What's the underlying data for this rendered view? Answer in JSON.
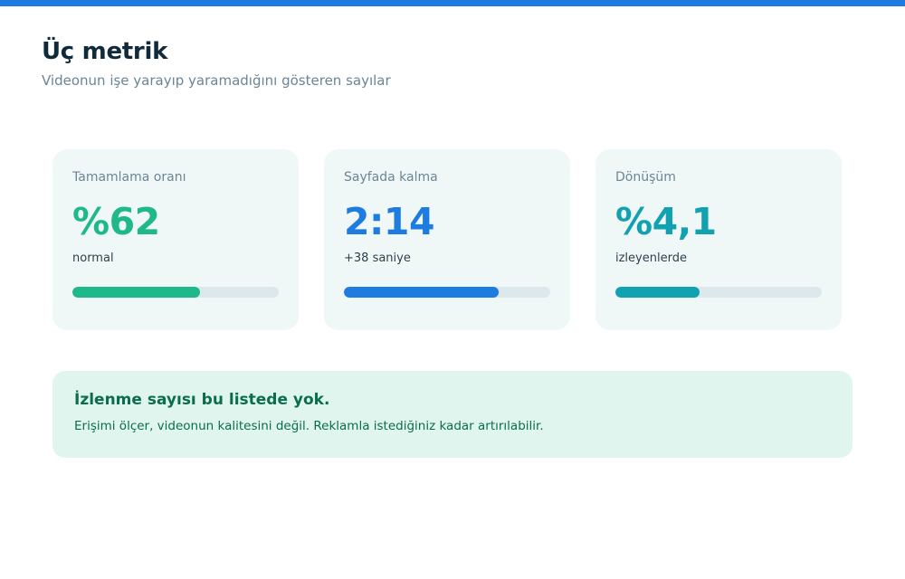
{
  "header": {
    "title": "Üç metrik",
    "subtitle": "Videonun işe yarayıp yaramadığını gösteren sayılar"
  },
  "colors": {
    "accent_bar": "#1e7be0",
    "green": "#1eb88a",
    "blue": "#1e7be0",
    "teal": "#11a1b0",
    "callout_bg": "#dff5ee",
    "callout_text": "#0b6e4a"
  },
  "metrics": [
    {
      "label": "Tamamlama oranı",
      "value": "%62",
      "note": "normal",
      "progress": 0.62
    },
    {
      "label": "Sayfada kalma",
      "value": "2:14",
      "note": "+38 saniye",
      "progress": 0.75
    },
    {
      "label": "Dönüşüm",
      "value": "%4,1",
      "note": "izleyenlerde",
      "progress": 0.41
    }
  ],
  "callout": {
    "title": "İzlenme sayısı bu listede yok.",
    "body": "Erişimi ölçer, videonun kalitesini değil. Reklamla istediğiniz kadar artırılabilir."
  }
}
